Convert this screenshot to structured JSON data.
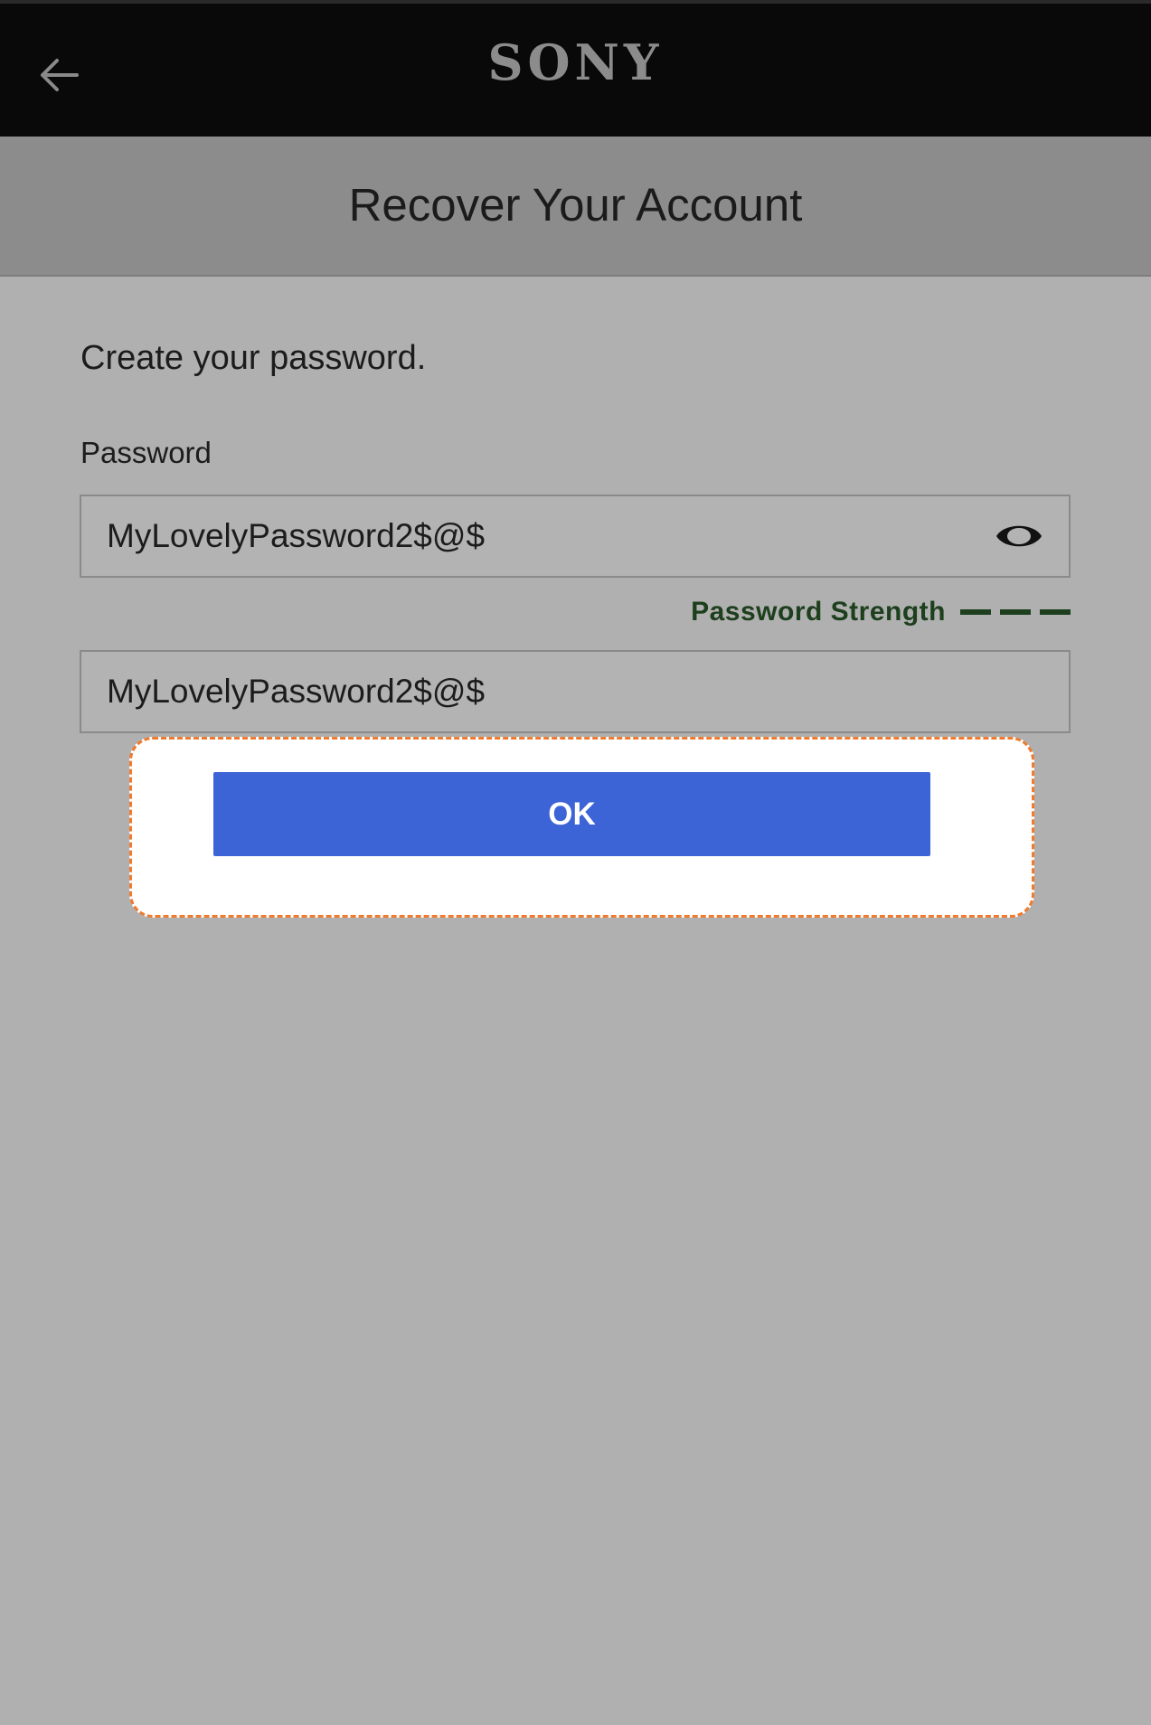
{
  "header": {
    "logo_text": "SONY",
    "back_icon": "arrow-left-icon"
  },
  "titlebar": {
    "title": "Recover Your Account"
  },
  "form": {
    "instruction": "Create your password.",
    "password_label": "Password",
    "password_value": "MyLovelyPassword2$@$",
    "show_password_icon": "eye-icon",
    "strength_label": "Password Strength",
    "strength_level_bars": 3,
    "confirm_value": "MyLovelyPassword2$@$",
    "ok_label": "OK"
  },
  "colors": {
    "topbar": "#090909",
    "titlebar": "#8c8c8c",
    "background": "#b0b0b0",
    "strength": "#1d3f1d",
    "button": "#3d64d6",
    "highlight_border": "#f07a2d"
  }
}
